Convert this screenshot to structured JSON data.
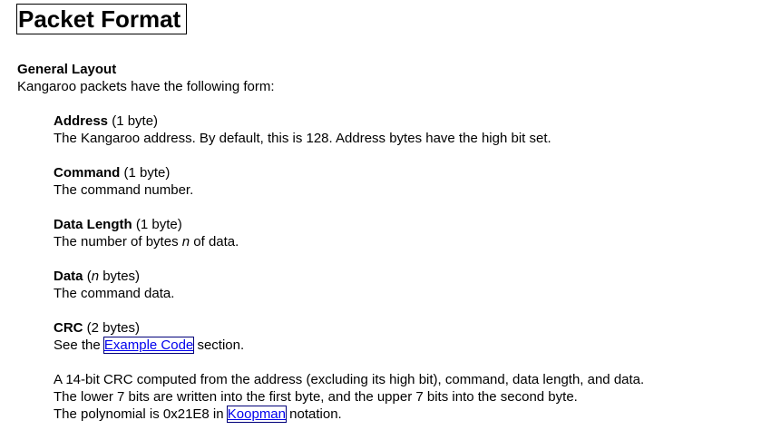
{
  "page": {
    "title": "Packet Format"
  },
  "general": {
    "heading": "General Layout",
    "intro": "Kangaroo packets have the following form:"
  },
  "fields": [
    {
      "name": "Address",
      "size": "(1 byte)",
      "description": "The Kangaroo address. By default, this is 128. Address bytes have the high bit set."
    },
    {
      "name": "Command",
      "size": "(1 byte)",
      "description": "The command number."
    },
    {
      "name": "Data Length",
      "size": "(1 byte)",
      "description_before": "The number of bytes ",
      "description_var": "n",
      "description_after": " of data."
    },
    {
      "name": "Data",
      "size_before": "(",
      "size_var": "n",
      "size_after": " bytes)",
      "description": "The command data."
    },
    {
      "name": "CRC",
      "size": "(2 bytes)",
      "see_before": "See the ",
      "see_link": "Example Code",
      "see_after": " section.",
      "line1": "A 14-bit CRC computed from the address (excluding its high bit), command, data length, and data.",
      "line2": "The lower 7 bits are written into the first byte, and the upper 7 bits into the second byte.",
      "line3_before": "The polynomial is 0x21E8 in ",
      "line3_link": "Koopman",
      "line3_after": " notation."
    }
  ]
}
